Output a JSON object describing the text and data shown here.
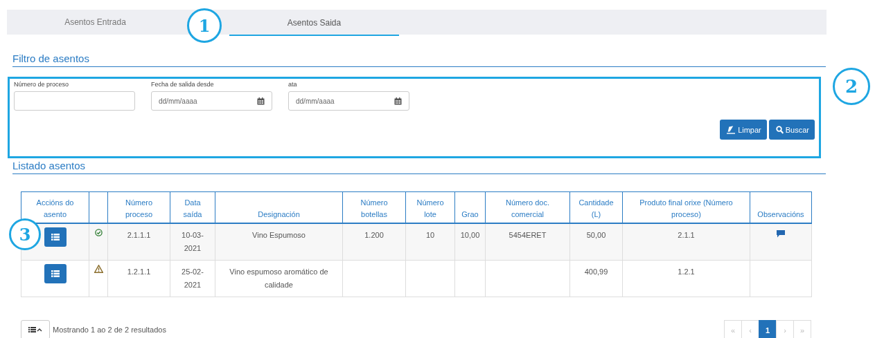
{
  "tabs": [
    {
      "label": "Asentos Entrada",
      "selected": false
    },
    {
      "label": "Asentos Saida",
      "selected": true
    }
  ],
  "filter": {
    "title": "Filtro de asentos",
    "fields": [
      {
        "label": "Número de proceso",
        "kind": "text"
      },
      {
        "label": "Fecha de salida desde",
        "kind": "date",
        "placeholder": "dd/mm/aaaa"
      },
      {
        "label": "ata",
        "kind": "date",
        "placeholder": "dd/mm/aaaa"
      }
    ],
    "buttons": [
      {
        "label": "Limpar"
      },
      {
        "label": "Buscar"
      }
    ]
  },
  "listing": {
    "title": "Listado asentos",
    "columns": [
      "Accións do asento",
      "",
      "Número proceso",
      "Data saída",
      "Designación",
      "Número botellas",
      "Número lote",
      "Grao",
      "Número doc. comercial",
      "Cantidade (L)",
      "Produto final orixe (Número proceso)",
      "Observacións"
    ],
    "rows": [
      {
        "kind": "ok",
        "numero_proceso": "2.1.1.1",
        "data_saida": "10-03-2021",
        "designacion": "Vino Espumoso",
        "botellas": "1.200",
        "lote": "10",
        "grao": "10,00",
        "doc_comercial": "5454ERET",
        "cantidade": "50,00",
        "produto_orixe": "2.1.1",
        "has_observation": true
      },
      {
        "kind": "warning",
        "numero_proceso": "1.2.1.1",
        "data_saida": "25-02-2021",
        "designacion": "Vino espumoso aromático de calidade",
        "botellas": "",
        "lote": "",
        "grao": "",
        "doc_comercial": "",
        "cantidade": "400,99",
        "produto_orixe": "1.2.1",
        "has_observation": false
      }
    ]
  },
  "footer": {
    "summary": "Mostrando 1 ao 2 de 2 resultados",
    "pages": [
      {
        "label": "«",
        "disabled": true,
        "selected": false
      },
      {
        "label": "‹",
        "disabled": true,
        "selected": false
      },
      {
        "label": "1",
        "disabled": false,
        "selected": true
      },
      {
        "label": "›",
        "disabled": true,
        "selected": false
      },
      {
        "label": "»",
        "disabled": true,
        "selected": false
      }
    ]
  },
  "callouts": [
    {
      "number": "1"
    },
    {
      "number": "2"
    },
    {
      "number": "3"
    }
  ]
}
